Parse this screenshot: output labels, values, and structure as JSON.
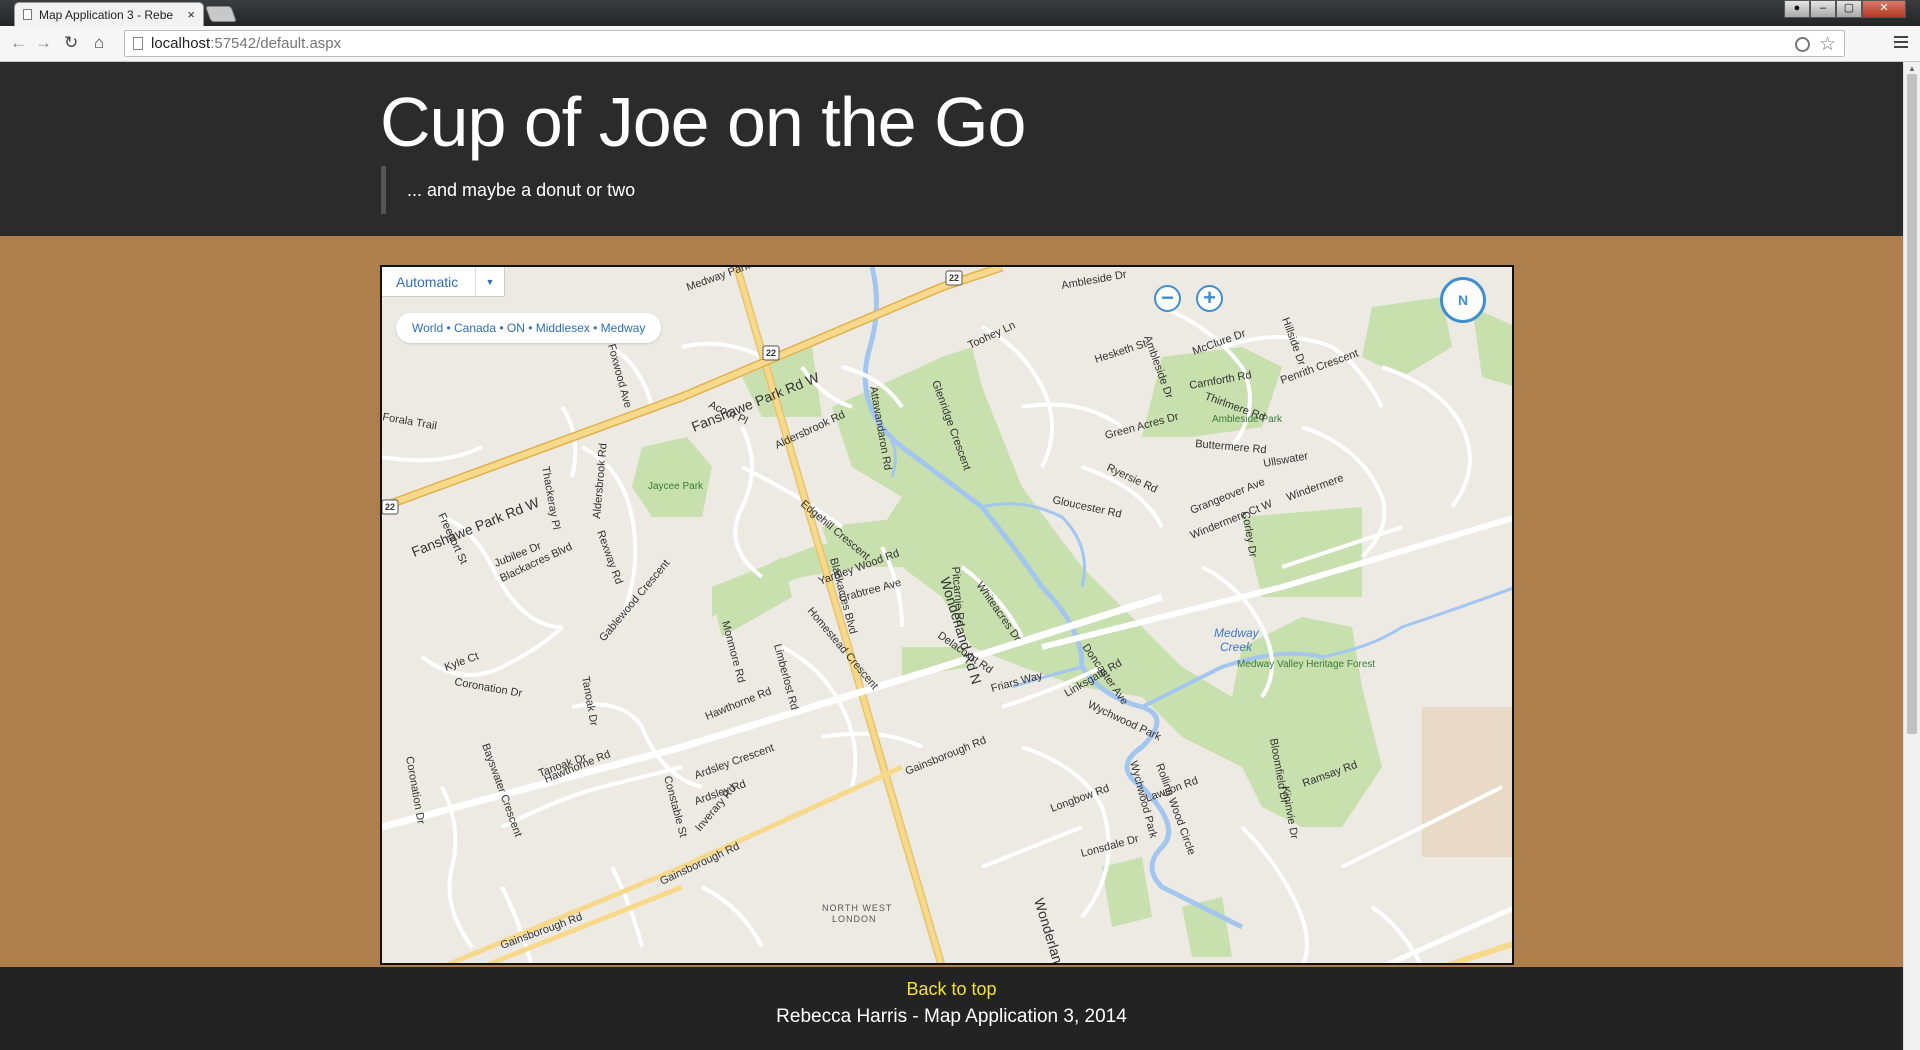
{
  "browser": {
    "tab_title": "Map Application 3 - Rebe",
    "tab_close": "×",
    "url_host": "localhost",
    "url_path": ":57542/default.aspx"
  },
  "header": {
    "title": "Cup of Joe on the Go",
    "tagline": "... and maybe a donut or two"
  },
  "map": {
    "map_style": "Automatic",
    "breadcrumb": "World • Canada • ON • Middlesex • Medway",
    "compass_label": "N",
    "labels": {
      "road_fanshawe_1": "Fanshawe Park Rd W",
      "road_fanshawe_2": "Fanshawe Park Rd W",
      "road_wonderland_1": "Wonderland Rd N",
      "road_wonderland_2": "Wonderland Rd",
      "road_gainsborough_1": "Gainsborough Rd",
      "road_gainsborough_2": "Gainsborough Rd",
      "road_gainsborough_3": "Gainsborough Rd",
      "road_hawthorne_1": "Hawthorne Rd",
      "road_hawthorne_2": "Hawthorne Rd",
      "road_blackacres_rd": "Blackacres Blvd",
      "road_blackacres_blvd": "Blackacres Blvd",
      "road_aldersbrook": "Aldersbrook Rd",
      "road_aldersbrook_2": "Aldersbrook Rd",
      "road_attawandaron": "Attawandaron Rd",
      "road_edgehill": "Edgehill Crescent",
      "road_yardley": "Yardley Wood Rd",
      "road_crabtree": "Crabtree Ave",
      "road_pitcarnie": "Pitcarnie Rd",
      "road_whiteacres": "Whiteacres Dr",
      "road_delacourt": "Delacourt Rd",
      "road_doncaster": "Doncaster Ave",
      "road_linksgate": "Linksgate Rd",
      "road_wychwood_park": "Wychwood Park",
      "road_friars": "Friars Way",
      "road_longbow": "Longbow Rd",
      "road_lawson": "Lawson Rd",
      "road_lonsdale": "Lonsdale Dr",
      "road_ramsay": "Ramsay Rd",
      "road_bloomfield": "Bloomfield Dr",
      "road_gloucester": "Gloucester Rd",
      "road_ryersie": "Ryersie Rd",
      "road_green_acres": "Green Acres Dr",
      "road_buttermere": "Buttermere Rd",
      "road_grangeover": "Grangeover Ave",
      "road_windermere": "Windermere Ct W",
      "road_carnforth": "Carnforth Rd",
      "road_thirlmere": "Thirlmere Rd",
      "road_mcclure": "McClure Dr",
      "road_hesketh": "Hesketh St",
      "road_ambleside_dr": "Ambleside Dr",
      "road_ambleside_dr2": "Ambleside Dr",
      "road_toohey": "Toohey Ln",
      "road_glenridge": "Glenridge Crescent",
      "road_foxwood": "Foxwood Ave",
      "road_medway_park": "Medway Park",
      "road_acorn": "Acorn Pl",
      "road_thackeray": "Thackeray Pl",
      "road_freeport": "Freeport St",
      "road_jubilee": "Jubilee Dr",
      "road_rexway": "Rexway Rd",
      "road_gablewood": "Gablewood Crescent",
      "road_monmore": "Monmore Rd",
      "road_limberlost": "Limberlost Rd",
      "road_homestead": "Homestead Crescent",
      "road_kyle": "Kyle Ct",
      "road_coronation": "Coronation Dr",
      "road_coronation_2": "Coronation Dr",
      "road_tanoak_dr": "Tanoak Dr",
      "road_tanoak_dr2": "Tanoak Dr",
      "road_bayswater": "Bayswater Crescent",
      "road_constable": "Constable St",
      "road_ardsley": "Ardsley Rd",
      "road_ardsley_cres": "Ardsley Crescent",
      "road_inverary": "Inverary Rd",
      "road_corley": "Corley Dr",
      "road_ullswater": "Ullswater",
      "road_hillside": "Hillside Dr",
      "road_penrith": "Penrith Crescent",
      "road_windermere_rd": "Windermere",
      "road_fowara": "Forala Trail",
      "road_wychwood_pk": "Wychwood Park",
      "road_rolling": "Rolling Wood Circle",
      "road_kininvie": "Kininvie Dr",
      "park_jaycee": "Jaycee Park",
      "park_ambleside": "Ambleside Park",
      "park_medway_valley": "Medway Valley Heritage Forest",
      "creek_medway_1": "Medway",
      "creek_medway_2": "Creek",
      "area_north_west_1": "NORTH WEST",
      "area_north_west_2": "LONDON",
      "shield_22_a": "22",
      "shield_22_b": "22",
      "shield_22_c": "22"
    }
  },
  "footer": {
    "back_to_top": "Back to top",
    "credit": "Rebecca Harris - Map Application 3, 2014"
  },
  "colors": {
    "header_bg": "#2b2b2b",
    "page_bg": "#ad7f4c",
    "footer_bg": "#232323",
    "link": "#f0e52c",
    "map_land": "#edeae4",
    "map_park": "#c8dfae",
    "map_water": "#a3c6ef",
    "map_highway": "#f6d98b",
    "map_accent": "#3f8ecf"
  }
}
